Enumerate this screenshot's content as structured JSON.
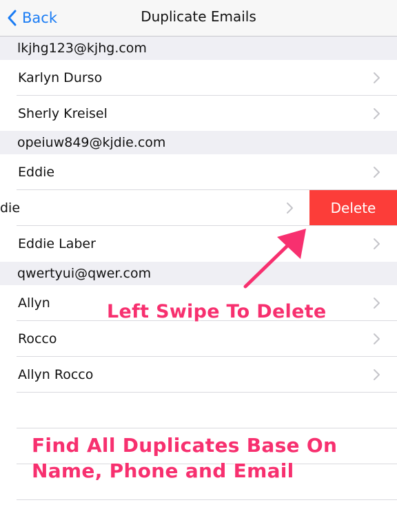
{
  "navbar": {
    "back_label": "Back",
    "title": "Duplicate Emails"
  },
  "groups": [
    {
      "email": "lkjhg123@kjhg.com",
      "contacts": [
        "Karlyn Durso",
        "Sherly Kreisel"
      ]
    },
    {
      "email": "opeiuw849@kjdie.com",
      "contacts": [
        "Eddie",
        "die",
        "Eddie Laber"
      ]
    },
    {
      "email": "qwertyui@qwer.com",
      "contacts": [
        "Allyn",
        "Rocco",
        "Allyn Rocco"
      ]
    }
  ],
  "swipe_action": {
    "delete_label": "Delete"
  },
  "promo": {
    "swipe_caption": "Left Swipe To Delete",
    "find_caption_line1": "Find All Duplicates Base On",
    "find_caption_line2": "Name, Phone and Email"
  },
  "colors": {
    "accent": "#1a7cf4",
    "delete": "#fc3d39",
    "promo": "#f7306f",
    "section_bg": "#efeff4"
  }
}
